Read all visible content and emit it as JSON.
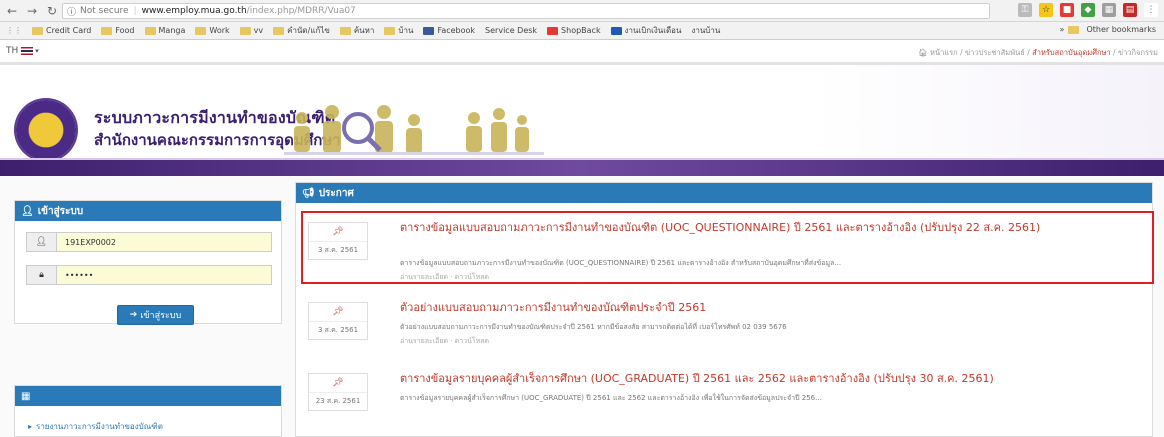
{
  "browser": {
    "address": {
      "security": "Not secure",
      "domain": "www.employ.mua.go.th",
      "path": "/index.php/MDRR/Vua07"
    },
    "bookmarks": [
      "Credit Card",
      "Food",
      "Manga",
      "Work",
      "vv",
      "คำนัด/แก้ไข",
      "ค้นหา",
      "บ้าน",
      "Facebook",
      "Service Desk",
      "ShopBack",
      "งานเบิกเงินเดือน",
      "งานบ้าน"
    ],
    "other_bookmarks": "Other bookmarks"
  },
  "site": {
    "lang": "TH",
    "breadcrumbs": [
      "หน้าแรก",
      "ข่าวประชาสัมพันธ์",
      "สำหรับสถาบันอุดมศึกษา",
      "ข่าวกิจกรรม"
    ],
    "title": "ระบบภาวะการมีงานทำของบัณฑิต",
    "subtitle": "สำนักงานคณะกรรมการการอุดมศึกษา"
  },
  "login": {
    "heading": "เข้าสู่ระบบ",
    "username_value": "191EXP0002",
    "password_value": "••••••",
    "button_label": "เข้าสู่ระบบ"
  },
  "menu": {
    "item": "รายงานภาวะการมีงานทำของบัณฑิต"
  },
  "news": {
    "heading": "ประกาศ",
    "items": [
      {
        "date": "3 ส.ค. 2561",
        "title": "ตารางข้อมูลแบบสอบถามภาวะการมีงานทำของบัณฑิต (UOC_QUESTIONNAIRE) ปี 2561 และตารางอ้างอิง (ปรับปรุง 22 ส.ค. 2561)",
        "desc": "ตารางข้อมูลแบบสอบถามภาวะการมีงานทำของบัณฑิต (UOC_QUESTIONNAIRE) ปี 2561 และตารางอ้างอิง สำหรับสถาบันอุดมศึกษาที่ส่งข้อมูล...",
        "meta": "อ่านรายละเอียด · ดาวน์โหลด"
      },
      {
        "date": "3 ส.ค. 2561",
        "title": "ตัวอย่างแบบสอบถามภาวะการมีงานทำของบัณฑิตประจำปี 2561",
        "desc": "ตัวอย่างแบบสอบถามภาวะการมีงานทำของบัณฑิตประจำปี 2561 หากมีข้อสงสัย สามารถติดต่อได้ที่ เบอร์โทรศัพท์ 02 039 5676",
        "meta": "อ่านรายละเอียด · ดาวน์โหลด"
      },
      {
        "date": "23 ส.ค. 2561",
        "title": "ตารางข้อมูลรายบุคคลผู้สำเร็จการศึกษา (UOC_GRADUATE) ปี 2561 และ 2562 และตารางอ้างอิง (ปรับปรุง 30 ส.ค. 2561)",
        "desc": "ตารางข้อมูลรายบุคคลผู้สำเร็จการศึกษา (UOC_GRADUATE) ปี 2561 และ 2562 และตารางอ้างอิง เพื่อใช้ในการจัดส่งข้อมูลประจำปี 256...",
        "meta": ""
      }
    ]
  }
}
